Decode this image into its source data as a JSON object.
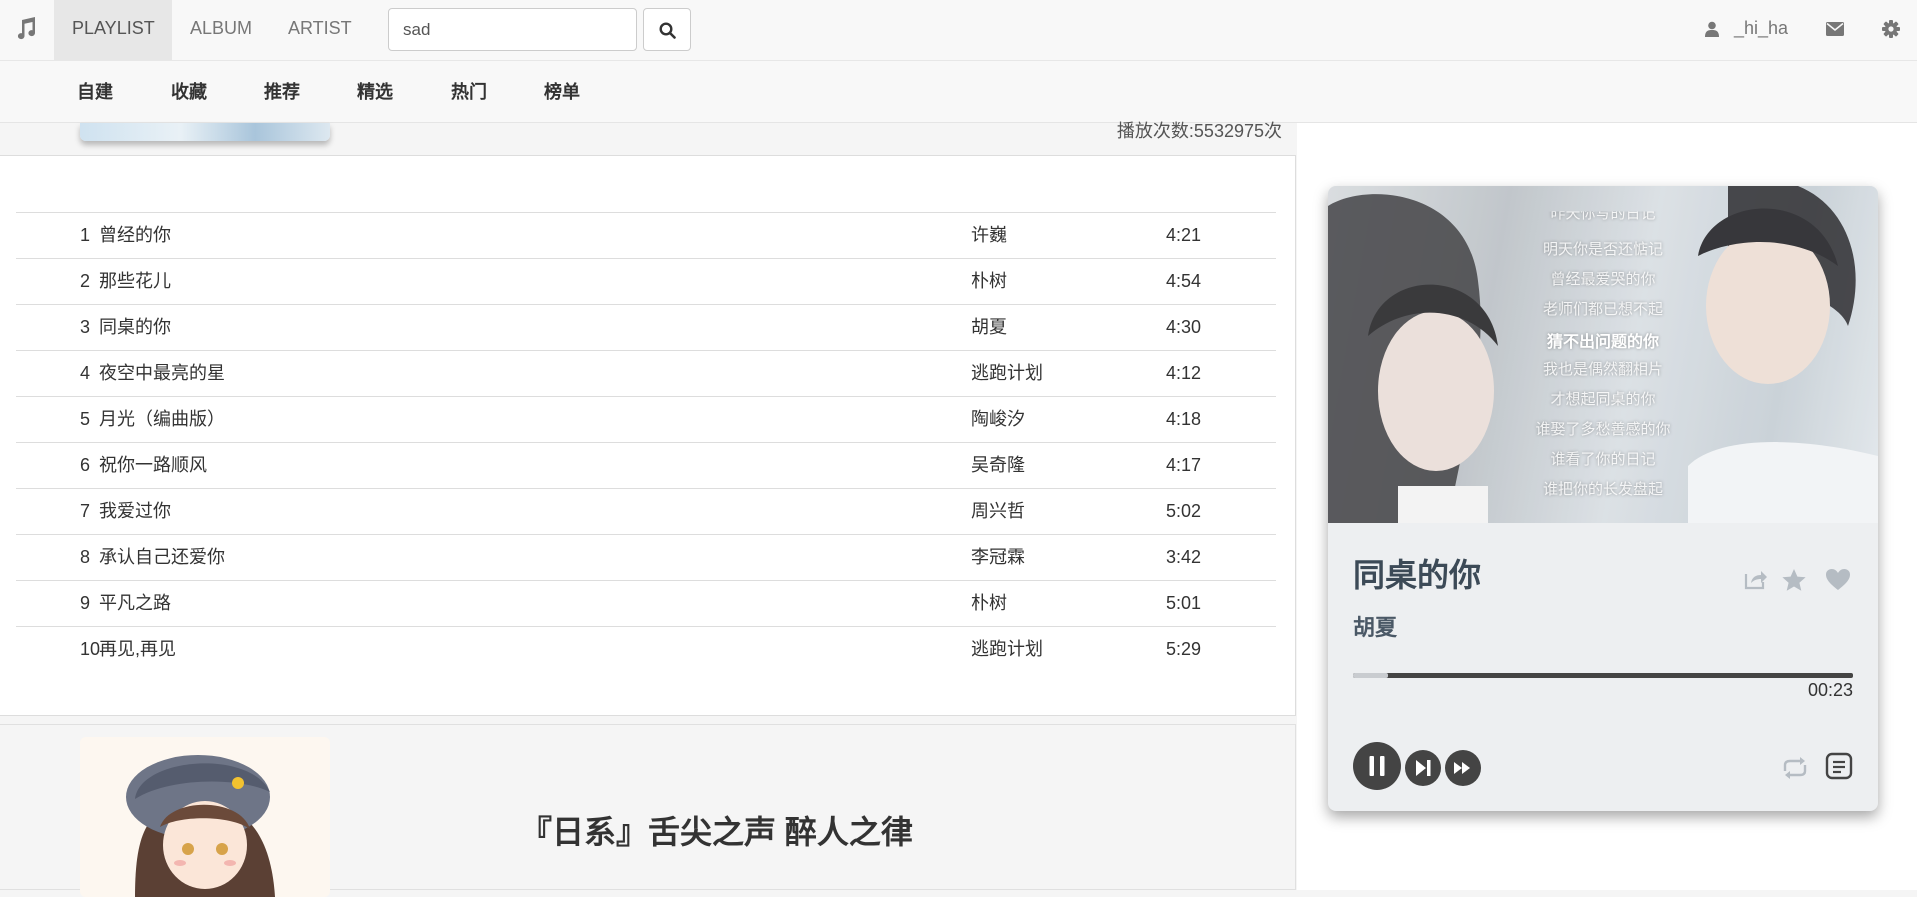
{
  "navbar": {
    "brand_icon": "music-note-icon",
    "tabs": [
      {
        "label": "PLAYLIST",
        "active": true
      },
      {
        "label": "ALBUM",
        "active": false
      },
      {
        "label": "ARTIST",
        "active": false
      }
    ],
    "search": {
      "value": "sad",
      "button_icon": "search-icon"
    },
    "user": {
      "icon": "user-icon",
      "name": "_hi_ha"
    },
    "mail_icon": "envelope-icon",
    "settings_icon": "gear-icon"
  },
  "subnav": {
    "items": [
      "自建",
      "收藏",
      "推荐",
      "精选",
      "热门",
      "榜单"
    ]
  },
  "playlist": {
    "play_count": "播放次数:5532975次",
    "tracks": [
      {
        "num": "1",
        "title": "曾经的你",
        "artist": "许巍",
        "duration": "4:21"
      },
      {
        "num": "2",
        "title": "那些花儿",
        "artist": "朴树",
        "duration": "4:54"
      },
      {
        "num": "3",
        "title": "同桌的你",
        "artist": "胡夏",
        "duration": "4:30"
      },
      {
        "num": "4",
        "title": "夜空中最亮的星",
        "artist": "逃跑计划",
        "duration": "4:12"
      },
      {
        "num": "5",
        "title": "月光（编曲版）",
        "artist": "陶峻汐",
        "duration": "4:18"
      },
      {
        "num": "6",
        "title": "祝你一路顺风",
        "artist": "吴奇隆",
        "duration": "4:17"
      },
      {
        "num": "7",
        "title": "我爱过你",
        "artist": "周兴哲",
        "duration": "5:02"
      },
      {
        "num": "8",
        "title": "承认自己还爱你",
        "artist": "李冠霖",
        "duration": "3:42"
      },
      {
        "num": "9",
        "title": "平凡之路",
        "artist": "朴树",
        "duration": "5:01"
      },
      {
        "num": "10",
        "title": "再见,再见",
        "artist": "逃跑计划",
        "duration": "5:29"
      }
    ]
  },
  "next_playlist": {
    "title": "『日系』舌尖之声 醉人之律"
  },
  "player": {
    "lyrics": [
      {
        "text": "昨天你写的日记",
        "current": false
      },
      {
        "text": "明天你是否还惦记",
        "current": false
      },
      {
        "text": "曾经最爱哭的你",
        "current": false
      },
      {
        "text": "老师们都已想不起",
        "current": false
      },
      {
        "text": "猜不出问题的你",
        "current": true
      },
      {
        "text": "我也是偶然翻相片",
        "current": false
      },
      {
        "text": "才想起同桌的你",
        "current": false
      },
      {
        "text": "谁娶了多愁善感的你",
        "current": false
      },
      {
        "text": "谁看了你的日记",
        "current": false
      },
      {
        "text": "谁把你的长发盘起",
        "current": false
      }
    ],
    "song_title": "同桌的你",
    "artist": "胡夏",
    "progress": 0.07,
    "time": "00:23",
    "icons": {
      "share": "share-icon",
      "star": "star-icon",
      "heart": "heart-icon",
      "pause": "pause-icon",
      "next": "skip-next-icon",
      "forward": "fast-forward-icon",
      "repeat": "repeat-icon",
      "list": "playlist-icon"
    },
    "colors": {
      "accent": "#3c4a57",
      "icon_muted": "#b5bcc3"
    }
  }
}
